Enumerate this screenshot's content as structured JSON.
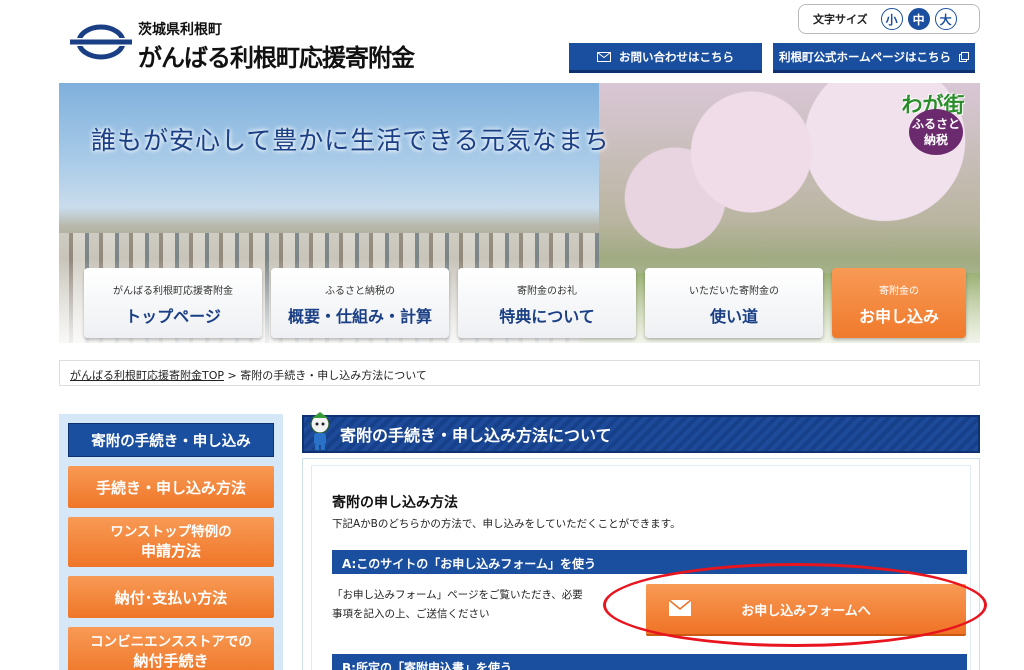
{
  "header": {
    "prefecture": "茨城県利根町",
    "site_title": "がんばる利根町応援寄附金",
    "font_size": {
      "label": "文字サイズ",
      "options": [
        "小",
        "中",
        "大"
      ],
      "selected": "中"
    },
    "contact_button": "お問い合わせはこちら",
    "official_button": "利根町公式ホームページはこちら"
  },
  "hero": {
    "slogan": "誰もが安心して豊かに生活できる元気なまち",
    "badge_line1": "わが街",
    "badge_line2": "ふるさと",
    "badge_line3": "納税"
  },
  "nav": [
    {
      "sub": "がんばる利根町応援寄附金",
      "main": "トップページ"
    },
    {
      "sub": "ふるさと納税の",
      "main": "概要・仕組み・計算"
    },
    {
      "sub": "寄附金のお礼",
      "main": "特典について"
    },
    {
      "sub": "いただいた寄附金の",
      "main": "使い道"
    },
    {
      "sub": "寄附金の",
      "main": "お申し込み"
    }
  ],
  "breadcrumb": {
    "home": "がんばる利根町応援寄附金TOP",
    "separator": ">",
    "current": "寄附の手続き・申し込み方法について"
  },
  "sidebar": {
    "heading": "寄附の手続き・申し込み",
    "items": [
      {
        "l1": "手続き・申し込み方法",
        "l2": ""
      },
      {
        "l1": "ワンストップ特例の",
        "l2": "申請方法"
      },
      {
        "l1": "納付･支払い方法",
        "l2": ""
      },
      {
        "l1": "コンビニエンスストアでの",
        "l2": "納付手続き"
      }
    ]
  },
  "main": {
    "page_title": "寄附の手続き・申し込み方法について",
    "section_title": "寄附の申し込み方法",
    "section_desc": "下記AかBのどちらかの方法で、申し込みをしていただくことができます。",
    "option_a": "A:このサイトの「お申し込みフォーム」を使う",
    "option_a_desc_1": "「お申し込みフォーム」ページをご覧いただき、必要",
    "option_a_desc_2": "事項を記入の上、ご送信ください",
    "form_button": "お申し込みフォームへ",
    "option_b": "B:所定の「寄附申込書」を使う"
  },
  "colors": {
    "brand_blue": "#1a4fa0",
    "accent_orange": "#f07a2c",
    "highlight_red": "#e8141e"
  }
}
